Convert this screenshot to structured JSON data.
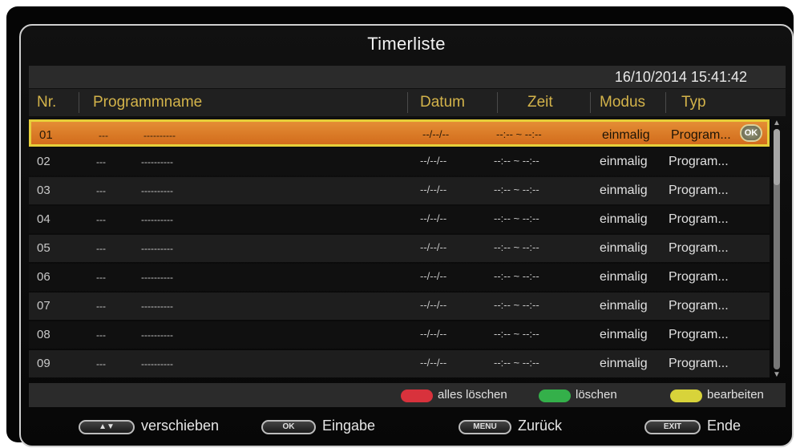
{
  "screen": {
    "title": "Timerliste",
    "datetime": "16/10/2014 15:41:42"
  },
  "columns": {
    "nr": "Nr.",
    "name": "Programmname",
    "datum": "Datum",
    "zeit": "Zeit",
    "modus": "Modus",
    "typ": "Typ"
  },
  "rows": [
    {
      "nr": "01",
      "dash": "---",
      "name": "----------",
      "datum": "--/--/--",
      "zeit": "--:-- ~ --:--",
      "modus": "einmalig",
      "typ": "Program..."
    },
    {
      "nr": "02",
      "dash": "---",
      "name": "----------",
      "datum": "--/--/--",
      "zeit": "--:-- ~ --:--",
      "modus": "einmalig",
      "typ": "Program..."
    },
    {
      "nr": "03",
      "dash": "---",
      "name": "----------",
      "datum": "--/--/--",
      "zeit": "--:-- ~ --:--",
      "modus": "einmalig",
      "typ": "Program..."
    },
    {
      "nr": "04",
      "dash": "---",
      "name": "----------",
      "datum": "--/--/--",
      "zeit": "--:-- ~ --:--",
      "modus": "einmalig",
      "typ": "Program..."
    },
    {
      "nr": "05",
      "dash": "---",
      "name": "----------",
      "datum": "--/--/--",
      "zeit": "--:-- ~ --:--",
      "modus": "einmalig",
      "typ": "Program..."
    },
    {
      "nr": "06",
      "dash": "---",
      "name": "----------",
      "datum": "--/--/--",
      "zeit": "--:-- ~ --:--",
      "modus": "einmalig",
      "typ": "Program..."
    },
    {
      "nr": "07",
      "dash": "---",
      "name": "----------",
      "datum": "--/--/--",
      "zeit": "--:-- ~ --:--",
      "modus": "einmalig",
      "typ": "Program..."
    },
    {
      "nr": "08",
      "dash": "---",
      "name": "----------",
      "datum": "--/--/--",
      "zeit": "--:-- ~ --:--",
      "modus": "einmalig",
      "typ": "Program..."
    },
    {
      "nr": "09",
      "dash": "---",
      "name": "----------",
      "datum": "--/--/--",
      "zeit": "--:-- ~ --:--",
      "modus": "einmalig",
      "typ": "Program..."
    }
  ],
  "selected_row": {
    "ok_badge": "OK"
  },
  "color_buttons": {
    "red": {
      "label": "alles löschen",
      "color": "#d8323c"
    },
    "green": {
      "label": "löschen",
      "color": "#34b04a"
    },
    "yellow": {
      "label": "bearbeiten",
      "color": "#d8d33a"
    }
  },
  "footer": {
    "move_key": "▲▼",
    "move_label": "verschieben",
    "ok_key": "OK",
    "ok_label": "Eingabe",
    "menu_key": "MENU",
    "menu_label": "Zurück",
    "exit_key": "EXIT",
    "exit_label": "Ende"
  },
  "colors": {
    "header_text": "#d3b34a",
    "selection": "#d97a27",
    "selection_border": "#e6cf3a"
  }
}
